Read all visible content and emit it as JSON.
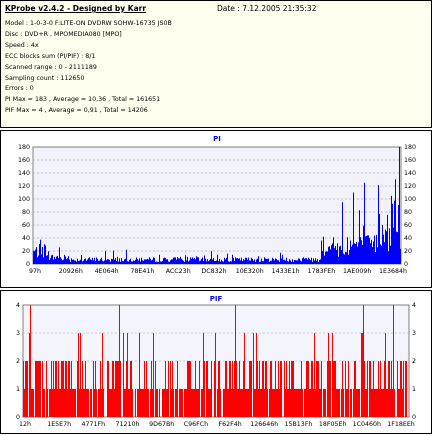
{
  "header": {
    "title": "KProbe v2.4.2 - Designed by Karr",
    "date": "Date : 7.12.2005 21:35:32",
    "lines": [
      "Model : 1-0-3-0 F:LITE-ON DVDRW SOHW-16735 JS0B",
      "Disc : DVD+R , MPOMEDIA080 [MPO]",
      "Speed : 4x",
      "ECC blocks sum (PI/PIF) : 8/1",
      "Scanned range : 0 - 2111189",
      "Sampling count : 112650",
      "Errors : 0",
      "PI Max = 183 , Average = 10,36 , Total = 161651",
      "PIF Max = 4 , Average = 0,91 , Total = 14206"
    ]
  },
  "chart_data": [
    {
      "type": "bar",
      "title": "PI",
      "ylim": [
        0,
        180
      ],
      "yticks": [
        "0",
        "20",
        "40",
        "60",
        "80",
        "100",
        "120",
        "140",
        "160",
        "180"
      ],
      "xticks": [
        "97h",
        "20926h",
        "4E064h",
        "78E41h",
        "ACC23h",
        "DC832h",
        "10E320h",
        "1433E1h",
        "1783FEh",
        "1AE009h",
        "1E3684h"
      ],
      "color": "#0000ff",
      "grid": true,
      "summary": {
        "max": 183,
        "average": 10.36,
        "total": 161651
      },
      "profile": [
        {
          "from": 0.0,
          "to": 0.02,
          "base": 22,
          "peak": 45
        },
        {
          "from": 0.02,
          "to": 0.1,
          "base": 12,
          "peak": 35
        },
        {
          "from": 0.1,
          "to": 0.6,
          "base": 8,
          "peak": 22
        },
        {
          "from": 0.6,
          "to": 0.78,
          "base": 8,
          "peak": 18
        },
        {
          "from": 0.78,
          "to": 0.86,
          "base": 25,
          "peak": 60
        },
        {
          "from": 0.86,
          "to": 0.93,
          "base": 35,
          "peak": 90
        },
        {
          "from": 0.93,
          "to": 1.0,
          "base": 45,
          "peak": 140
        }
      ]
    },
    {
      "type": "bar",
      "title": "PIF",
      "ylim": [
        0,
        4
      ],
      "yticks": [
        "0",
        "1",
        "2",
        "3",
        "4"
      ],
      "xticks": [
        "12h",
        "1E5E7h",
        "4771Fh",
        "71210h",
        "9D67Bh",
        "C96FCh",
        "F62F4h",
        "126646h",
        "15B13Fh",
        "18F05Eh",
        "1C0460h",
        "1F18EEh"
      ],
      "color": "#ff0000",
      "grid": true,
      "summary": {
        "max": 4,
        "average": 0.91,
        "total": 14206
      }
    }
  ]
}
